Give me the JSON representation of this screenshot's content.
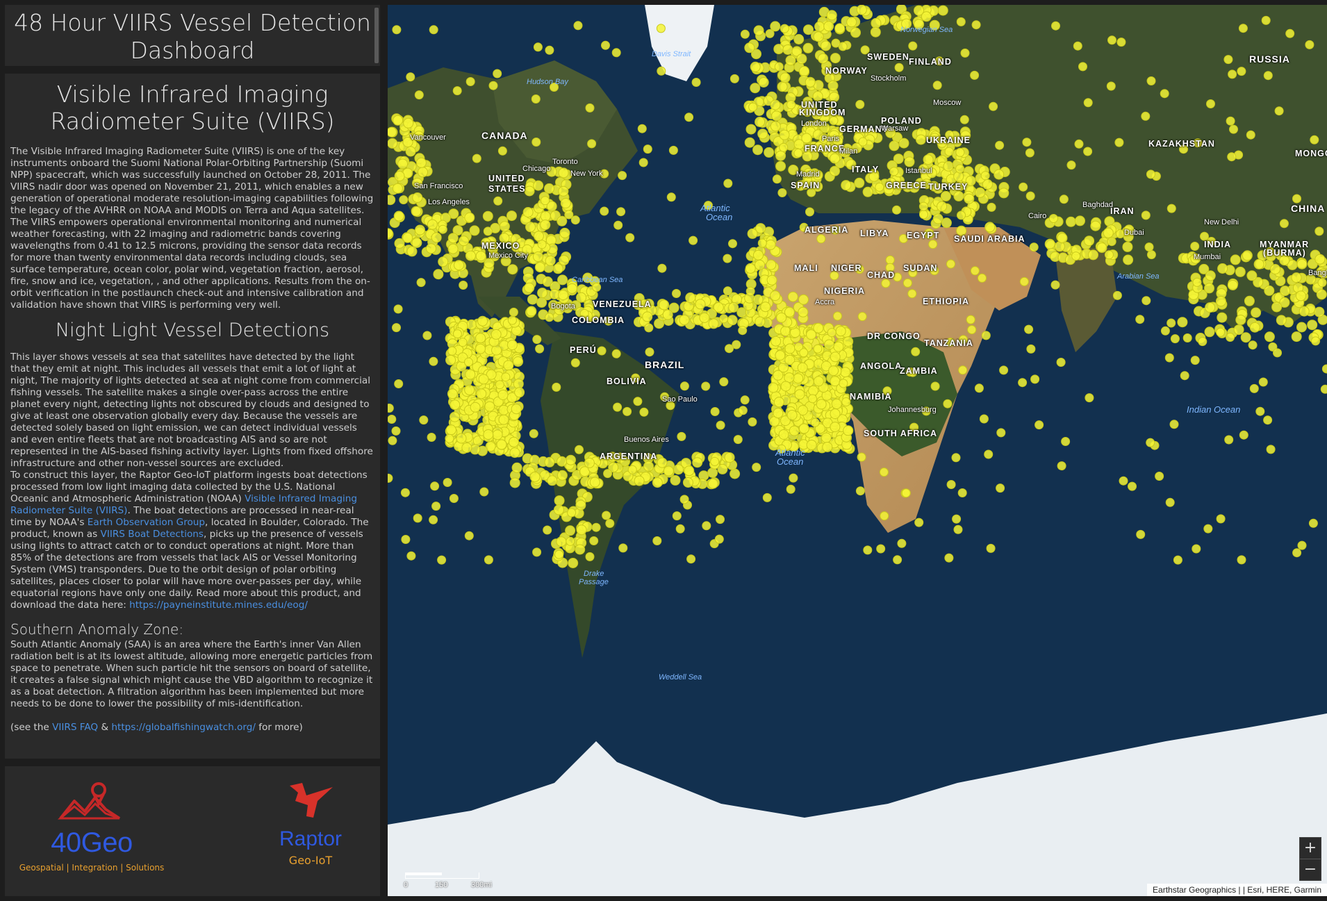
{
  "header": {
    "title": "48 Hour VIIRS Vessel Detection Dashboard"
  },
  "info": {
    "heading1": "Visible Infrared Imaging Radiometer Suite (VIIRS)",
    "para1": "The Visible Infrared Imaging Radiometer Suite (VIIRS) is one of the key instruments onboard the Suomi National Polar-Orbiting Partnership (Suomi NPP) spacecraft, which was successfully launched on October 28, 2011. The VIIRS nadir door was opened on November 21, 2011, which enables a new generation of operational moderate resolution-imaging capabilities following the legacy of the AVHRR on NOAA and MODIS on Terra and Aqua satellites. The VIIRS empowers operational environmental monitoring and numerical weather forecasting, with 22 imaging and radiometric bands covering wavelengths from 0.41 to 12.5 microns, providing the sensor data records for more than twenty environmental data records including clouds, sea surface temperature, ocean color, polar wind, vegetation fraction, aerosol, fire, snow and ice, vegetation, , and other applications. Results from the on-orbit verification in the postlaunch check-out and intensive calibration and validation have shown that VIIRS is performing very well.",
    "heading2": "Night Light Vessel Detections",
    "para2": "This layer shows vessels at sea that satellites have detected by the light that they emit at night. This includes all vessels that emit a lot of light at night, The majority of lights detected at sea at night come from commercial fishing vessels. The satellite makes a single over-pass across the entire planet every night, detecting lights not obscured by clouds and designed to give at least one observation globally every day. Because the vessels are detected solely based on light emission, we can detect individual vessels and even entire fleets that are not broadcasting AIS and so are not represented in the AIS-based fishing activity layer. Lights from fixed offshore infrastructure and other non-vessel sources are excluded.",
    "para3_a": "To construct this layer, the Raptor Geo-IoT platform ingests boat detections processed from low light imaging data collected by the U.S. National Oceanic and Atmospheric Administration (NOAA) ",
    "para3_link1": "Visible Infrared Imaging Radiometer Suite (VIIRS)",
    "para3_b": ". The boat detections are processed in near-real time by NOAA's ",
    "para3_link2": "Earth Observation Group",
    "para3_c": ", located in Boulder, Colorado. The product, known as ",
    "para3_link3": "VIIRS Boat Detections",
    "para3_d": ", picks up the presence of vessels using lights to attract catch or to conduct operations at night. More than 85% of the detections are from vessels that lack AIS or Vessel Monitoring System (VMS) transponders. Due to the orbit design of polar orbiting satellites, places closer to polar will have more over-passes per day, while equatorial regions have only one daily. Read more about this product, and download the data here: ",
    "para3_link4": "https://payneinstitute.mines.edu/eog/",
    "heading3": "Southern Anomaly Zone:",
    "para4": "South Atlantic Anomaly (SAA) is an area where the Earth's inner Van Allen radiation belt is at its lowest altitude, allowing more energetic particles from space to penetrate. When such particle hit the sensors on board of satellite, it creates a false signal which might cause the VBD algorithm to recognize it as a boat detection. A filtration algorithm has been implemented but more needs to be done to lower the possibility of mis-identification.",
    "para5_a": "(see the ",
    "para5_link1": "VIIRS FAQ",
    "para5_b": " & ",
    "para5_link2": "https://globalfishingwatch.org/",
    "para5_c": " for more)"
  },
  "logos": {
    "geo40_name": "40Geo",
    "geo40_tag": "Geospatial | Integration | Solutions",
    "raptor_name": "Raptor",
    "raptor_tag": "Geo-IoT"
  },
  "map": {
    "labels": [
      {
        "id": "canada",
        "text": "CANADA",
        "kind": "country"
      },
      {
        "id": "us1",
        "text": "UNITED",
        "kind": "country"
      },
      {
        "id": "us2",
        "text": "STATES",
        "kind": "country"
      },
      {
        "id": "mexico",
        "text": "MEXICO",
        "kind": "country"
      },
      {
        "id": "venezuela",
        "text": "VENEZUELA",
        "kind": "country"
      },
      {
        "id": "colombia",
        "text": "COLOMBIA",
        "kind": "country"
      },
      {
        "id": "peru",
        "text": "PERÚ",
        "kind": "country"
      },
      {
        "id": "brazil",
        "text": "BRAZIL",
        "kind": "country"
      },
      {
        "id": "bolivia",
        "text": "BOLIVIA",
        "kind": "country"
      },
      {
        "id": "argentina",
        "text": "ARGENTINA",
        "kind": "country"
      },
      {
        "id": "russia",
        "text": "RUSSIA",
        "kind": "country"
      },
      {
        "id": "sweden",
        "text": "SWEDEN",
        "kind": "country"
      },
      {
        "id": "finland",
        "text": "FINLAND",
        "kind": "country"
      },
      {
        "id": "norway",
        "text": "NORWAY",
        "kind": "country"
      },
      {
        "id": "uk1",
        "text": "UNITED",
        "kind": "country"
      },
      {
        "id": "uk2",
        "text": "KINGDOM",
        "kind": "country"
      },
      {
        "id": "germany",
        "text": "GERMANY",
        "kind": "country"
      },
      {
        "id": "poland",
        "text": "POLAND",
        "kind": "country"
      },
      {
        "id": "ukraine",
        "text": "UKRAINE",
        "kind": "country"
      },
      {
        "id": "france",
        "text": "FRANCE",
        "kind": "country"
      },
      {
        "id": "italy",
        "text": "ITALY",
        "kind": "country"
      },
      {
        "id": "spain",
        "text": "SPAIN",
        "kind": "country"
      },
      {
        "id": "greece",
        "text": "GREECE",
        "kind": "country"
      },
      {
        "id": "turkey",
        "text": "TURKEY",
        "kind": "country"
      },
      {
        "id": "kazakhstan",
        "text": "KAZAKHSTAN",
        "kind": "country"
      },
      {
        "id": "mongolia",
        "text": "MONGOL",
        "kind": "country"
      },
      {
        "id": "china",
        "text": "CHINA",
        "kind": "country"
      },
      {
        "id": "iran",
        "text": "IRAN",
        "kind": "country"
      },
      {
        "id": "india",
        "text": "INDIA",
        "kind": "country"
      },
      {
        "id": "myanmar",
        "text": "MYANMAR",
        "kind": "country"
      },
      {
        "id": "burma",
        "text": "(BURMA)",
        "kind": "country"
      },
      {
        "id": "algeria",
        "text": "ALGERIA",
        "kind": "country"
      },
      {
        "id": "libya",
        "text": "LIBYA",
        "kind": "country"
      },
      {
        "id": "egypt",
        "text": "EGYPT",
        "kind": "country"
      },
      {
        "id": "saudi",
        "text": "SAUDI ARABIA",
        "kind": "country"
      },
      {
        "id": "mali",
        "text": "MALI",
        "kind": "country"
      },
      {
        "id": "niger",
        "text": "NIGER",
        "kind": "country"
      },
      {
        "id": "chad",
        "text": "CHAD",
        "kind": "country"
      },
      {
        "id": "sudan",
        "text": "SUDAN",
        "kind": "country"
      },
      {
        "id": "nigeria",
        "text": "NIGERIA",
        "kind": "country"
      },
      {
        "id": "ethiopia",
        "text": "ETHIOPIA",
        "kind": "country"
      },
      {
        "id": "drc",
        "text": "DR CONGO",
        "kind": "country"
      },
      {
        "id": "tanzania",
        "text": "TANZANIA",
        "kind": "country"
      },
      {
        "id": "angola",
        "text": "ANGOLA",
        "kind": "country"
      },
      {
        "id": "zambia",
        "text": "ZAMBIA",
        "kind": "country"
      },
      {
        "id": "namibia",
        "text": "NAMIBIA",
        "kind": "country"
      },
      {
        "id": "southafrica",
        "text": "SOUTH AFRICA",
        "kind": "country"
      },
      {
        "id": "vancouver",
        "text": "Vancouver",
        "kind": "city"
      },
      {
        "id": "toronto",
        "text": "Toronto",
        "kind": "city"
      },
      {
        "id": "chicago",
        "text": "Chicago",
        "kind": "city"
      },
      {
        "id": "newyork",
        "text": "New York",
        "kind": "city"
      },
      {
        "id": "sanfrancisco",
        "text": "San Francisco",
        "kind": "city"
      },
      {
        "id": "losangeles",
        "text": "Los Angeles",
        "kind": "city"
      },
      {
        "id": "mexicocity",
        "text": "Mexico City",
        "kind": "city"
      },
      {
        "id": "bogota",
        "text": "Bogota",
        "kind": "city"
      },
      {
        "id": "saopaulo",
        "text": "Sao Paulo",
        "kind": "city"
      },
      {
        "id": "buenosaires",
        "text": "Buenos Aires",
        "kind": "city"
      },
      {
        "id": "stockholm",
        "text": "Stockholm",
        "kind": "city"
      },
      {
        "id": "moscow",
        "text": "Moscow",
        "kind": "city"
      },
      {
        "id": "london",
        "text": "London",
        "kind": "city"
      },
      {
        "id": "paris",
        "text": "Paris",
        "kind": "city"
      },
      {
        "id": "warsaw",
        "text": "Warsaw",
        "kind": "city"
      },
      {
        "id": "milan",
        "text": "Milan",
        "kind": "city"
      },
      {
        "id": "madrid",
        "text": "Madrid",
        "kind": "city"
      },
      {
        "id": "istanbul",
        "text": "Istanbul",
        "kind": "city"
      },
      {
        "id": "baghdad",
        "text": "Baghdad",
        "kind": "city"
      },
      {
        "id": "cairo",
        "text": "Cairo",
        "kind": "city"
      },
      {
        "id": "dubai",
        "text": "Dubai",
        "kind": "city"
      },
      {
        "id": "newdelhi",
        "text": "New Delhi",
        "kind": "city"
      },
      {
        "id": "mumbai",
        "text": "Mumbai",
        "kind": "city"
      },
      {
        "id": "bangkok",
        "text": "Bangko",
        "kind": "city"
      },
      {
        "id": "accra",
        "text": "Accra",
        "kind": "city"
      },
      {
        "id": "johannesburg",
        "text": "Johannesburg",
        "kind": "city"
      },
      {
        "id": "norwegiansea",
        "text": "Norwegian Sea",
        "kind": "ocean"
      },
      {
        "id": "davisstrait",
        "text": "Davis Strait",
        "kind": "ocean"
      },
      {
        "id": "hudsonbay",
        "text": "Hudson Bay",
        "kind": "ocean"
      },
      {
        "id": "atlantic1a",
        "text": "Atlantic",
        "kind": "ocean"
      },
      {
        "id": "atlantic1b",
        "text": "Ocean",
        "kind": "ocean"
      },
      {
        "id": "caribbean",
        "text": "Caribbean Sea",
        "kind": "ocean"
      },
      {
        "id": "arabiansea",
        "text": "Arabian Sea",
        "kind": "ocean"
      },
      {
        "id": "indianocean",
        "text": "Indian Ocean",
        "kind": "ocean"
      },
      {
        "id": "atlantic2a",
        "text": "Atlantic",
        "kind": "ocean"
      },
      {
        "id": "atlantic2b",
        "text": "Ocean",
        "kind": "ocean"
      },
      {
        "id": "drake1",
        "text": "Drake",
        "kind": "ocean"
      },
      {
        "id": "drake2",
        "text": "Passage",
        "kind": "ocean"
      },
      {
        "id": "weddell",
        "text": "Weddell Sea",
        "kind": "ocean"
      }
    ],
    "scale_0": "0",
    "scale_150": "150",
    "scale_300": "300mi",
    "zoom_in": "+",
    "zoom_out": "−",
    "attribution": "Earthstar Geographics | | Esri, HERE, Garmin",
    "detection_color": "#f5f536"
  }
}
